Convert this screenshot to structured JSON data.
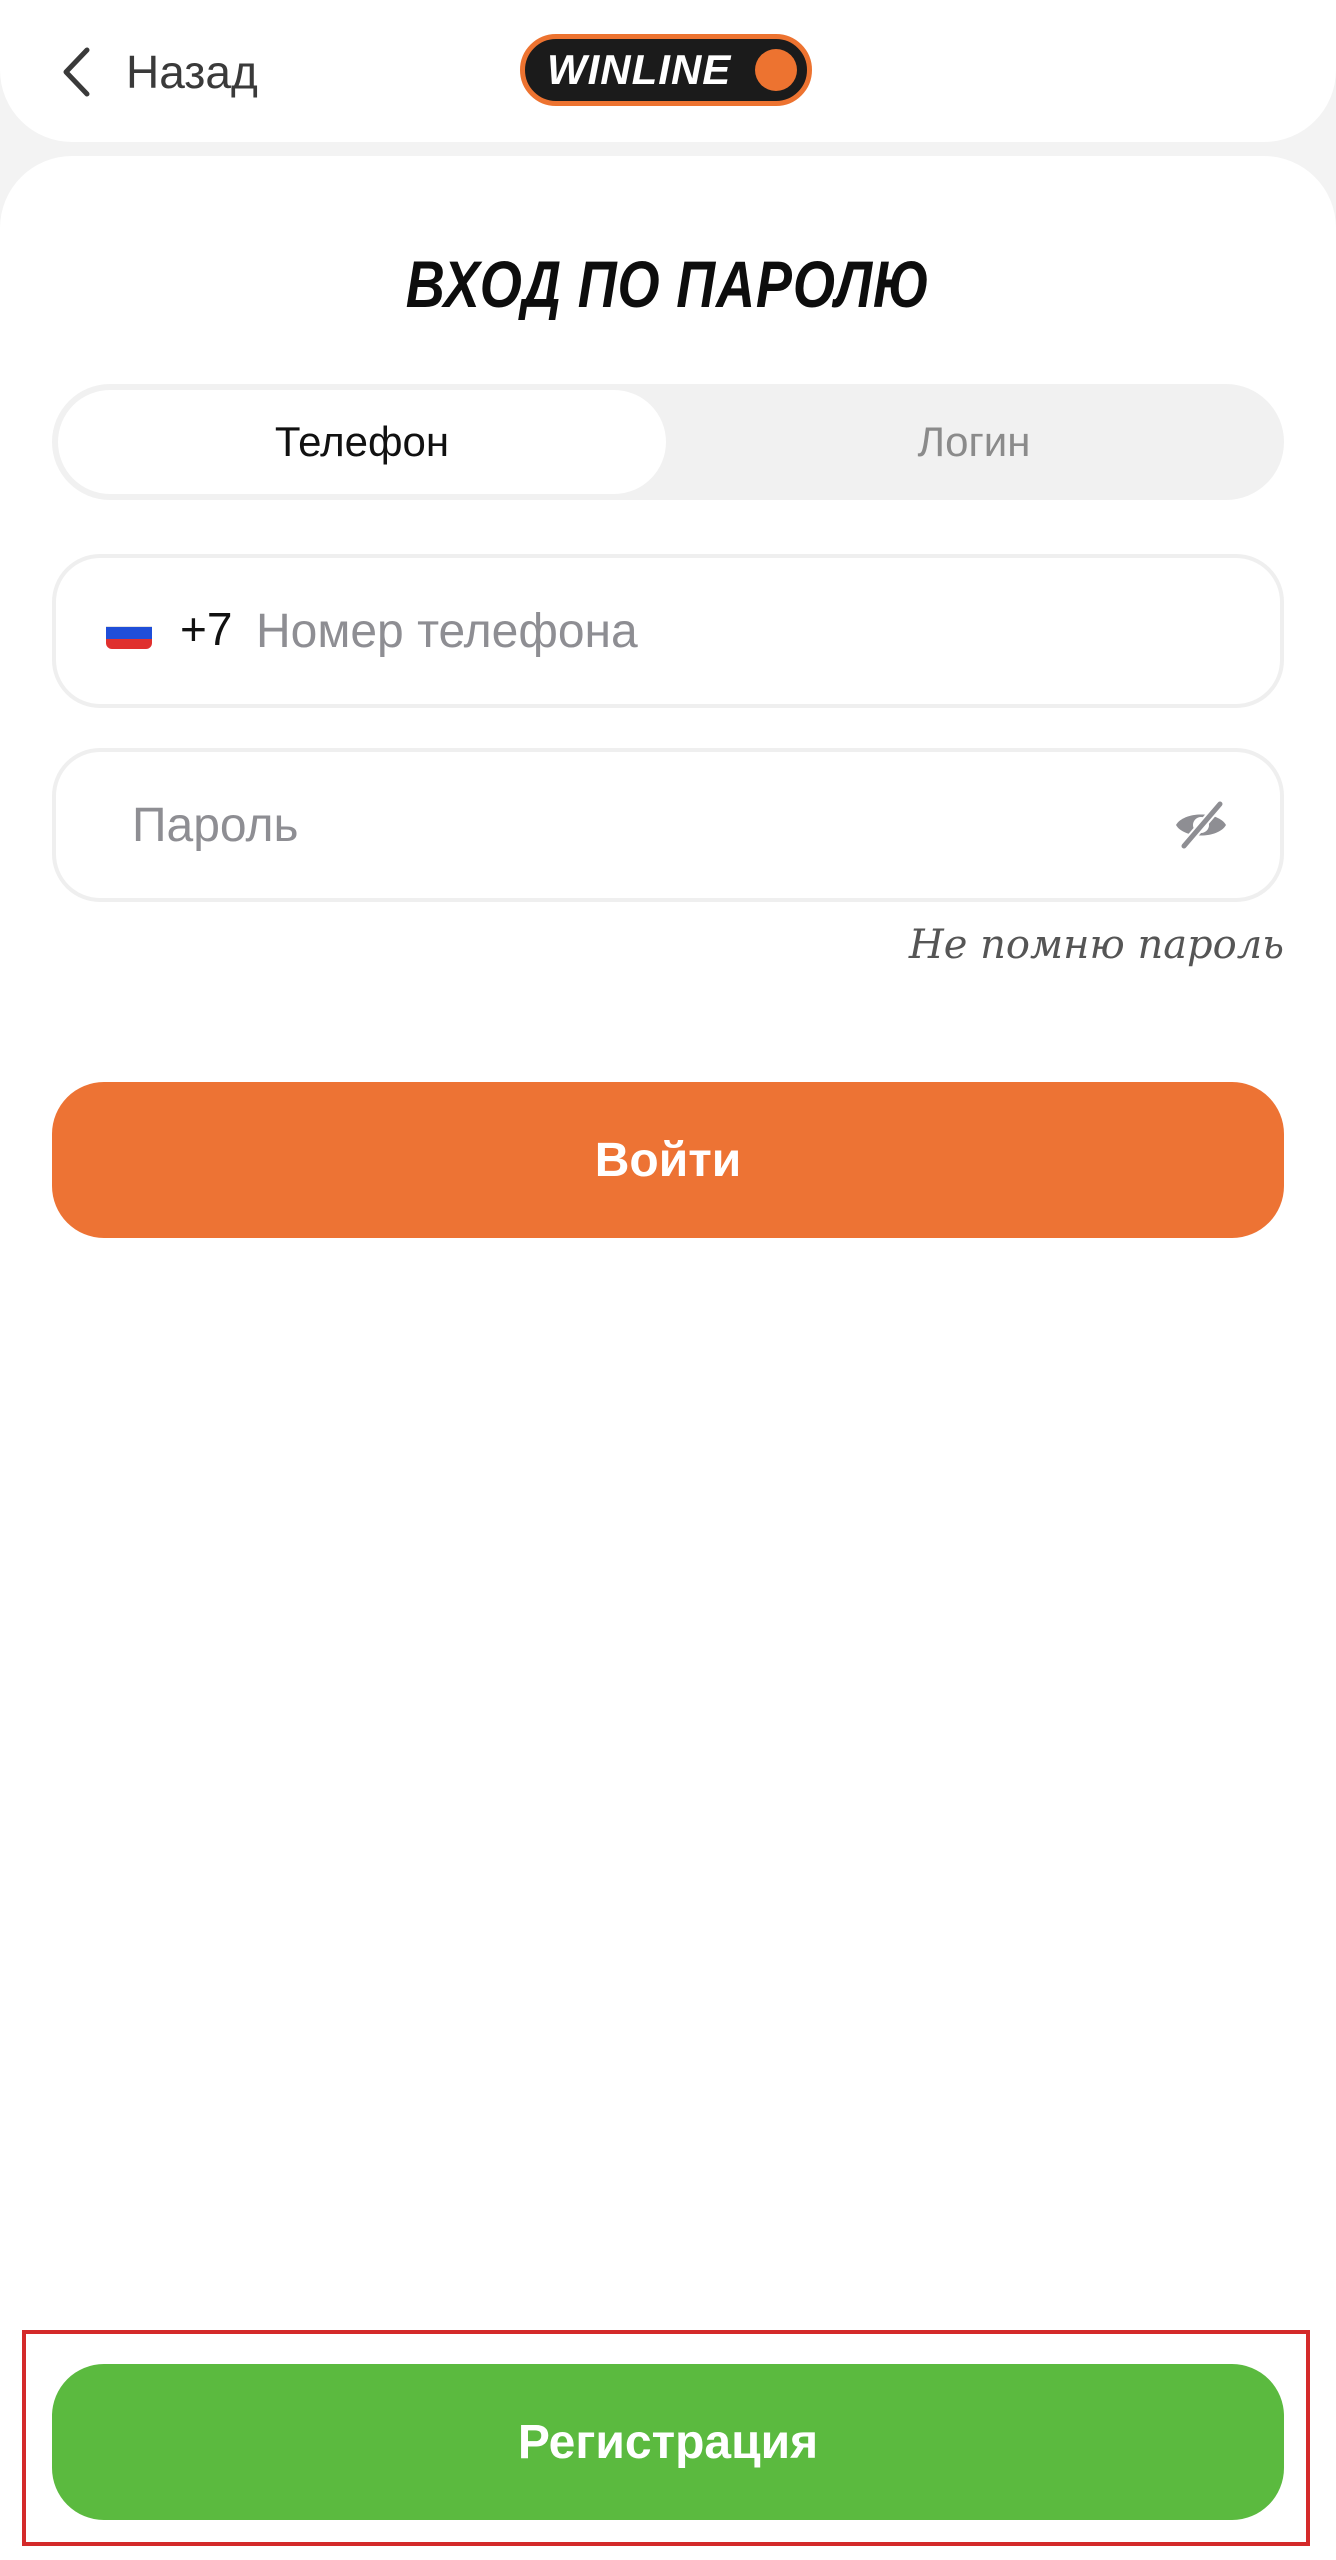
{
  "header": {
    "back_label": "Назад",
    "logo_text": "WINLINE"
  },
  "page": {
    "title": "ВХОД ПО ПАРОЛЮ"
  },
  "tabs": [
    {
      "label": "Телефон",
      "active": true
    },
    {
      "label": "Логин",
      "active": false
    }
  ],
  "phone_field": {
    "country_code": "+7",
    "placeholder": "Номер телефона",
    "value": "",
    "flag_icon": "russia-flag-icon"
  },
  "password_field": {
    "placeholder": "Пароль",
    "value": "",
    "toggle_icon": "eye-off-icon"
  },
  "forgot_password_label": "Не помню пароль",
  "login_button_label": "Войти",
  "register_button_label": "Регистрация",
  "colors": {
    "accent_orange": "#ed7334",
    "register_green": "#5bba3f",
    "highlight_red": "#d42a2a",
    "logo_dark": "#1b1b1b"
  }
}
